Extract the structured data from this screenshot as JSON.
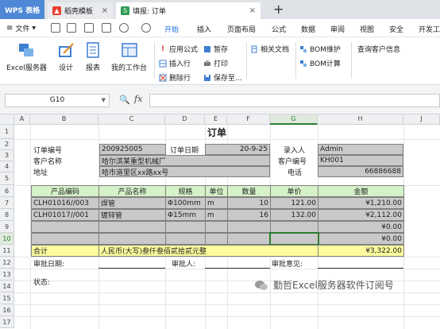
{
  "titlebar": {
    "tabs": [
      {
        "label": "WPS 表格"
      },
      {
        "label": "稻壳模板"
      },
      {
        "label": "填报: 订单"
      }
    ],
    "tab_icon_s": "S",
    "close_glyph": "×",
    "new_tab": "+"
  },
  "menubar": {
    "file_label": "文件",
    "items": [
      "开始",
      "插入",
      "页面布局",
      "公式",
      "数据",
      "审阅",
      "视图",
      "安全",
      "开发工"
    ],
    "active_color": "#1e6fd9"
  },
  "ribbon": {
    "big": [
      {
        "label": "Excel服务器",
        "icon": "server-icon"
      },
      {
        "label": "设计",
        "icon": "design-icon"
      },
      {
        "label": "报表",
        "icon": "report-icon"
      },
      {
        "label": "我的工作台",
        "icon": "workbench-icon"
      }
    ],
    "small": [
      {
        "label": "应用公式",
        "icon": "exclamation-icon"
      },
      {
        "label": "暂存",
        "icon": "save-icon"
      },
      {
        "label": "插入行",
        "icon": "insert-row-icon"
      },
      {
        "label": "打印",
        "icon": "print-icon"
      },
      {
        "label": "删除行",
        "icon": "delete-row-icon"
      },
      {
        "label": "保存至...",
        "icon": "save-to-icon"
      },
      {
        "label": "相关文档",
        "icon": "document-icon"
      },
      {
        "label": "BOM维护",
        "icon": "bom-icon"
      },
      {
        "label": "BOM计算",
        "icon": "bom-icon"
      },
      {
        "label": "查询客户信息",
        "icon": "query-icon"
      }
    ]
  },
  "formula_bar": {
    "cell_ref": "G10",
    "zoom_icon": "🔍",
    "fx": "fx",
    "value": ""
  },
  "grid": {
    "columns": [
      "A",
      "B",
      "C",
      "D",
      "E",
      "F",
      "G",
      "H",
      "J"
    ],
    "rows": [
      "1",
      "2",
      "3",
      "4",
      "5",
      "6",
      "7",
      "8",
      "9",
      "10",
      "11",
      "12",
      "13",
      "14",
      "15",
      "16",
      "17",
      "18"
    ],
    "selected_col": "G",
    "selected_row": "10"
  },
  "sheet": {
    "title": "订单",
    "order_no_label": "订单编号",
    "order_no": "200925005",
    "order_date_label": "订单日期",
    "order_date": "20-9-25",
    "entered_by_label": "录入人",
    "entered_by": "Admin",
    "customer_name_label": "客户名称",
    "customer_name": "哈尔滨某重型机械厂",
    "customer_code_label": "客户编号",
    "customer_code": "KH001",
    "address_label": "地址",
    "address": "哈市道里区xx路xx号",
    "phone_label": "电话",
    "phone": "66886688",
    "table_headers": [
      "产品编码",
      "产品名称",
      "规格",
      "单位",
      "数量",
      "单价",
      "金额"
    ],
    "items": [
      {
        "code": "CLH01016//003",
        "name": "焊管",
        "spec": "Φ100mm",
        "unit": "m",
        "qty": "10",
        "price": "121.00",
        "amount": "¥1,210.00"
      },
      {
        "code": "CLH01017//001",
        "name": "镀锌管",
        "spec": "Φ15mm",
        "unit": "m",
        "qty": "16",
        "price": "132.00",
        "amount": "¥2,112.00"
      },
      {
        "code": "",
        "name": "",
        "spec": "",
        "unit": "",
        "qty": "",
        "price": "",
        "amount": "¥0.00"
      },
      {
        "code": "",
        "name": "",
        "spec": "",
        "unit": "",
        "qty": "",
        "price": "",
        "amount": "¥0.00"
      }
    ],
    "total_label": "合计",
    "total_words": "人民币(大写)叁仟叁佰贰拾贰元整",
    "total_amount": "¥3,322.00",
    "approval_date_label": "审批日期:",
    "approver_label": "审批人:",
    "approval_opinion_label": "审批意见:",
    "status_label": "状态:"
  },
  "watermark": {
    "text": "勤哲Excel服务器软件订阅号"
  },
  "colors": {
    "wps_blue": "#4e88d6",
    "header_green": "#d5f1c8",
    "total_yellow": "#fefb9e",
    "field_gray": "#c9c9c9",
    "selection_green": "#2e7d32"
  }
}
